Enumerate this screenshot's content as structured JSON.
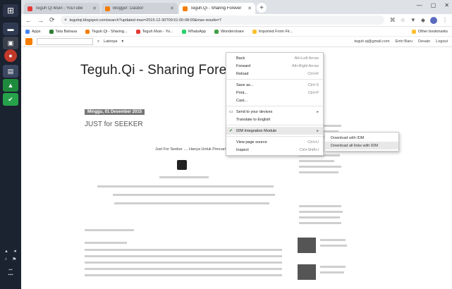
{
  "browser": {
    "tabs": [
      {
        "title": "Teguh Qi Muin - YouTube",
        "favicon_color": "#e53935",
        "active": false
      },
      {
        "title": "Blogger: Dasbor",
        "favicon_color": "#f57d00",
        "active": false
      },
      {
        "title": "Teguh.Qi - Sharing Forever",
        "favicon_color": "#f57d00",
        "active": true
      }
    ],
    "new_tab": "+",
    "url": "teguhqi.blogspot.com/search?updated-max=2015-12-30T09:51:00-08:00&max-results=7",
    "bookmarks": [
      {
        "label": "Apps",
        "color": "#4285f4"
      },
      {
        "label": "Tata Bahasa",
        "color": "#2e7d32"
      },
      {
        "label": "Teguh.Qi - Sharing...",
        "color": "#f57d00"
      },
      {
        "label": "Teguh Muin - Yo...",
        "color": "#e53935"
      },
      {
        "label": "WhatsApp",
        "color": "#25d366"
      },
      {
        "label": "Wondershare",
        "color": "#43a047"
      },
      {
        "label": "Imported From Fir...",
        "color": "#fbc02d"
      }
    ],
    "other_bookmarks": "Other bookmarks"
  },
  "blogger_bar": {
    "more_label": "Lainnya",
    "right": [
      "teguh.qi@gmail.com",
      "Entri Baru",
      "Desain",
      "Logout"
    ]
  },
  "blog": {
    "title": "Teguh.Qi - Sharing Forever",
    "date": "Minggu, 01 Desember 2015",
    "post_title": "JUST for SEEKER",
    "post_subtitle": "Just For Seeker .... Hanya Untuk Pencari"
  },
  "context_menu": {
    "items": [
      {
        "label": "Back",
        "shortcut": "Alt+Left Arrow"
      },
      {
        "label": "Forward",
        "shortcut": "Alt+Right Arrow"
      },
      {
        "label": "Reload",
        "shortcut": "Ctrl+R"
      },
      {
        "sep": true
      },
      {
        "label": "Save as...",
        "shortcut": "Ctrl+S"
      },
      {
        "label": "Print...",
        "shortcut": "Ctrl+P"
      },
      {
        "label": "Cast...",
        "shortcut": ""
      },
      {
        "sep": true
      },
      {
        "label": "Send to your devices",
        "icon": "devices-icon",
        "submenu": true
      },
      {
        "label": "Translate to English",
        "shortcut": ""
      },
      {
        "sep": true
      },
      {
        "label": "IDM Integration Module",
        "icon": "idm-icon",
        "submenu": true,
        "highlight": true
      },
      {
        "sep": true
      },
      {
        "label": "View page source",
        "shortcut": "Ctrl+U"
      },
      {
        "label": "Inspect",
        "shortcut": "Ctrl+Shift+I"
      }
    ]
  },
  "submenu": {
    "items": [
      {
        "label": "Download with IDM"
      },
      {
        "label": "Download all links with IDM",
        "highlight": true
      }
    ]
  }
}
